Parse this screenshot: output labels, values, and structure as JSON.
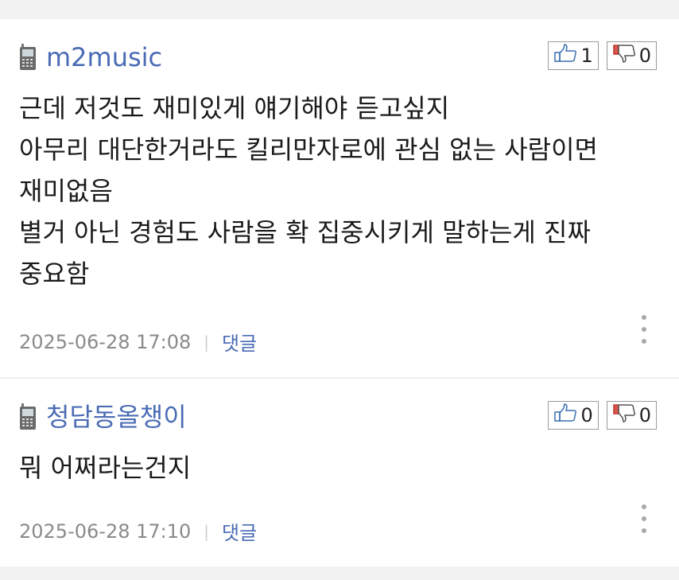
{
  "comments": [
    {
      "author": "m2music",
      "likes": "1",
      "dislikes": "0",
      "lines": [
        "근데 저것도 재미있게 얘기해야 듣고싶지",
        "아무리 대단한거라도 킬리만자로에 관심 없는 사람이면",
        "재미없음",
        "별거 아닌 경험도 사람을 확 집중시키게 말하는게 진짜",
        "중요함"
      ],
      "timestamp": "2025-06-28 17:08",
      "separator": "|",
      "reply_label": "댓글"
    },
    {
      "author": "청담동올챙이",
      "likes": "0",
      "dislikes": "0",
      "lines": [
        "뭐 어쩌라는건지"
      ],
      "timestamp": "2025-06-28 17:10",
      "separator": "|",
      "reply_label": "댓글"
    }
  ],
  "icons": {
    "author_icon": "mobile-phone-icon",
    "like_icon": "thumbs-up-icon",
    "dislike_icon": "thumbs-down-icon",
    "more_icon": "more-vertical-icon"
  },
  "colors": {
    "author": "#4a6bb5",
    "reply_link": "#4a6bb5",
    "timestamp": "#8a8a8a",
    "background": "#f2f2f2",
    "card": "#ffffff"
  }
}
